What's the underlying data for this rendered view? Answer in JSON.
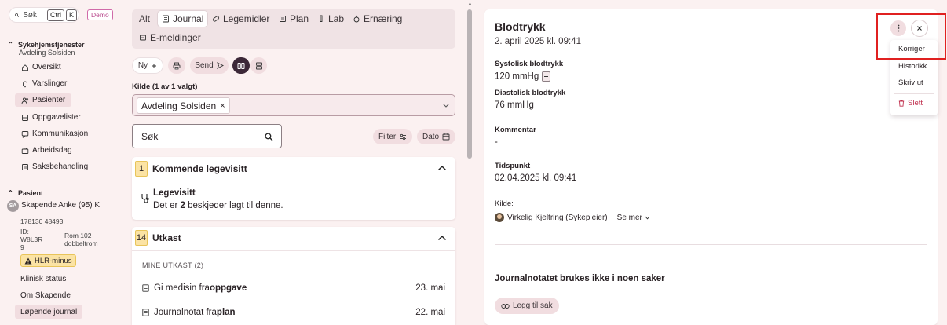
{
  "sidebar": {
    "search": {
      "label": "Søk",
      "kbd1": "Ctrl",
      "kbd2": "K"
    },
    "demo_badge": "Demo",
    "section1": {
      "title": "Sykehjemstjenester",
      "subtitle": "Avdeling Solsiden"
    },
    "nav": [
      {
        "label": "Oversikt",
        "icon": "home-icon"
      },
      {
        "label": "Varslinger",
        "icon": "bell-icon"
      },
      {
        "label": "Pasienter",
        "icon": "users-icon",
        "active": true
      },
      {
        "label": "Oppgavelister",
        "icon": "tray-icon"
      },
      {
        "label": "Kommunikasjon",
        "icon": "chat-icon"
      },
      {
        "label": "Arbeidsdag",
        "icon": "briefcase-icon"
      },
      {
        "label": "Saksbehandling",
        "icon": "doc-icon"
      }
    ],
    "section2": {
      "title": "Pasient"
    },
    "patient": {
      "initials": "SA",
      "name": "Skapende Anke (95) K",
      "ssn": "178130 48493",
      "id": "ID: W8L3R 9",
      "room": "Rom 102 · dobbeltrom",
      "badge": "HLR-minus"
    },
    "patient_nav": [
      {
        "label": "Klinisk status"
      },
      {
        "label": "Om Skapende"
      },
      {
        "label": "Løpende journal",
        "active": true
      }
    ]
  },
  "tabs": [
    {
      "label": "Alt",
      "icon": ""
    },
    {
      "label": "Journal",
      "icon": "journal-icon",
      "active": true
    },
    {
      "label": "Legemidler",
      "icon": "pill-icon"
    },
    {
      "label": "Plan",
      "icon": "plan-icon"
    },
    {
      "label": "Lab",
      "icon": "lab-icon"
    },
    {
      "label": "Ernæring",
      "icon": "nutrition-icon"
    },
    {
      "label": "E-meldinger",
      "icon": "message-icon"
    }
  ],
  "actions": {
    "new_label": "Ny",
    "send_label": "Send"
  },
  "kilde": {
    "label": "Kilde (1 av 1 valgt)",
    "selected": "Avdeling Solsiden"
  },
  "search": {
    "placeholder": "Søk"
  },
  "filters": {
    "filter_label": "Filter",
    "date_label": "Dato"
  },
  "kommende": {
    "count": "1",
    "title": "Kommende legevisitt",
    "item_title": "Legevisitt",
    "item_text_pre": "Det er ",
    "item_text_num": "2",
    "item_text_post": " beskjeder lagt til denne."
  },
  "utkast": {
    "count": "14",
    "title": "Utkast",
    "section_label": "MINE UTKAST (2)",
    "rows": [
      {
        "text": "Gi medisin fra ",
        "bold": "oppgave",
        "date": "23. mai"
      },
      {
        "text": "Journalnotat fra ",
        "bold": "plan",
        "date": "22. mai"
      }
    ]
  },
  "detail": {
    "title": "Blodtrykk",
    "date": "2. april 2025 kl. 09:41",
    "systolic_label": "Systolisk blodtrykk",
    "systolic_value": "120 mmHg",
    "diastolic_label": "Diastolisk blodtrykk",
    "diastolic_value": "76 mmHg",
    "comment_label": "Kommentar",
    "comment_value": "-",
    "time_label": "Tidspunkt",
    "time_value": "02.04.2025 kl. 09:41",
    "source_label": "Kilde:",
    "source_person": "Virkelig Kjeltring (Sykepleier)",
    "see_more": "Se mer",
    "cases_heading": "Journalnotatet brukes ikke i noen saker",
    "add_case_label": "Legg til sak"
  },
  "menu": {
    "items": [
      "Korriger",
      "Historikk",
      "Skriv ut"
    ],
    "delete": "Slett"
  },
  "colors": {
    "accent_dark": "#3c2838",
    "pink_bg": "#fbf1f1",
    "chip_bg": "#f1dde0",
    "badge_yellow": "#fbe3a4",
    "delete_red": "#c0304e",
    "highlight_red": "#e02020"
  }
}
